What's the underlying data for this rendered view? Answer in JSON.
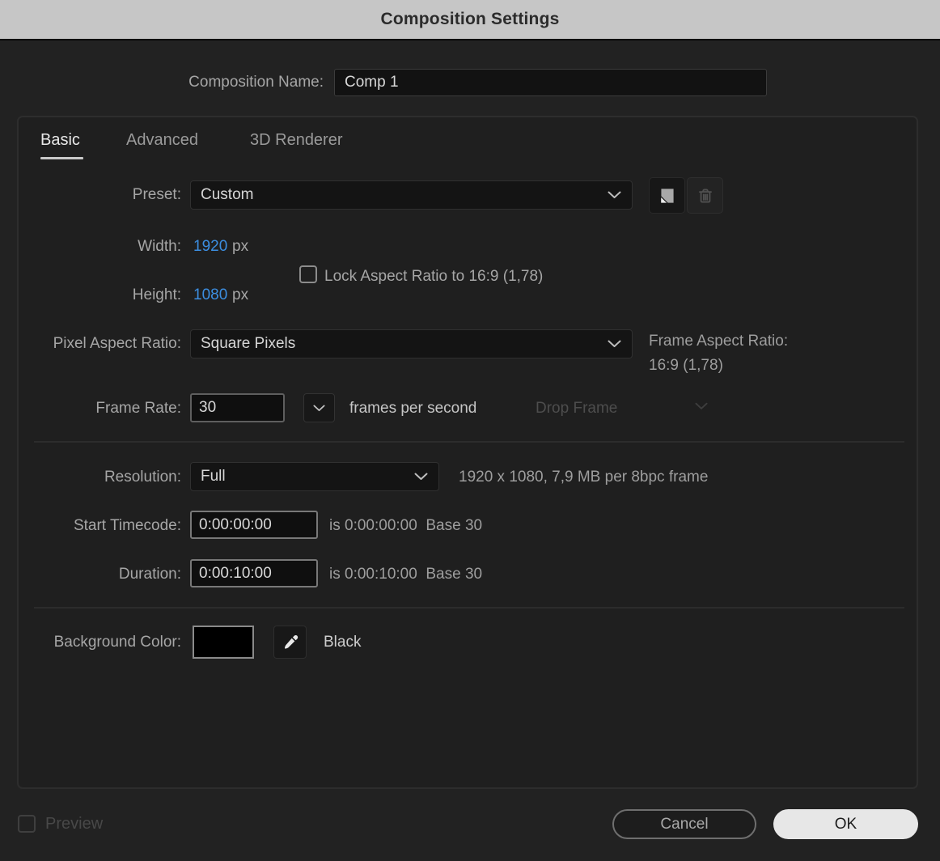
{
  "dialog": {
    "title": "Composition Settings"
  },
  "name_row": {
    "label": "Composition Name:",
    "value": "Comp 1"
  },
  "tabs": [
    {
      "label": "Basic",
      "active": true
    },
    {
      "label": "Advanced",
      "active": false
    },
    {
      "label": "3D Renderer",
      "active": false
    }
  ],
  "basic": {
    "preset": {
      "label": "Preset:",
      "value": "Custom"
    },
    "width": {
      "label": "Width:",
      "value": "1920",
      "unit": "px"
    },
    "height": {
      "label": "Height:",
      "value": "1080",
      "unit": "px"
    },
    "lock_aspect": {
      "label": "Lock Aspect Ratio to 16:9 (1,78)",
      "checked": false
    },
    "pixel_aspect_ratio": {
      "label": "Pixel Aspect Ratio:",
      "value": "Square Pixels"
    },
    "frame_aspect_ratio": {
      "label": "Frame Aspect Ratio:",
      "value": "16:9 (1,78)"
    },
    "frame_rate": {
      "label": "Frame Rate:",
      "value": "30",
      "suffix": "frames per second",
      "timecode_style": "Drop Frame",
      "timecode_style_enabled": false
    },
    "resolution": {
      "label": "Resolution:",
      "value": "Full",
      "info": "1920 x 1080, 7,9 MB per 8bpc frame"
    },
    "start_timecode": {
      "label": "Start Timecode:",
      "value": "0:00:00:00",
      "info": "is 0:00:00:00  Base 30"
    },
    "duration": {
      "label": "Duration:",
      "value": "0:00:10:00",
      "info": "is 0:00:10:00  Base 30"
    },
    "background_color": {
      "label": "Background Color:",
      "swatch_hex": "#000000",
      "color_name": "Black"
    }
  },
  "footer": {
    "preview": {
      "label": "Preview",
      "checked": false,
      "enabled": false
    },
    "cancel_label": "Cancel",
    "ok_label": "OK"
  },
  "colors": {
    "accent_blue": "#3c8ee0",
    "titlebar_bg": "#c6c6c6",
    "window_bg": "#222222",
    "panel_bg": "#1f1f1f"
  }
}
